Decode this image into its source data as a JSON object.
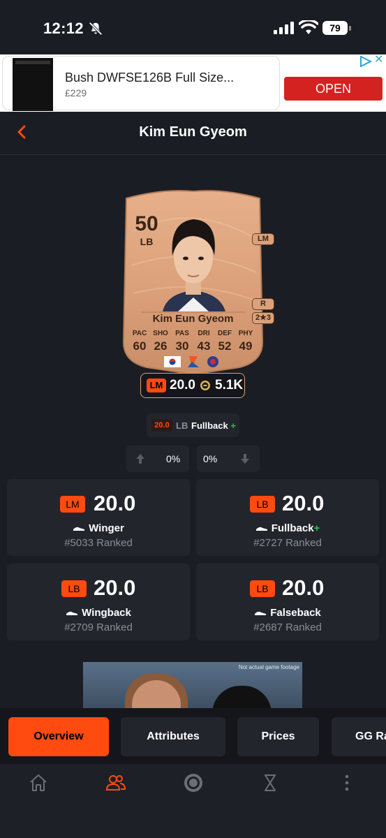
{
  "status": {
    "time": "12:12",
    "battery": "79"
  },
  "ad": {
    "title": "Bush DWFSE126B Full Size...",
    "price": "£229",
    "cta": "OPEN",
    "close": "✕"
  },
  "header": {
    "title": "Kim Eun Gyeom"
  },
  "card": {
    "rating": "50",
    "position": "LB",
    "alt_positions": [
      "LM",
      "R",
      "2★3"
    ],
    "name": "Kim Eun Gyeom",
    "stats": [
      {
        "label": "PAC",
        "value": "60"
      },
      {
        "label": "SHO",
        "value": "26"
      },
      {
        "label": "PAS",
        "value": "30"
      },
      {
        "label": "DRI",
        "value": "43"
      },
      {
        "label": "DEF",
        "value": "52"
      },
      {
        "label": "PHY",
        "value": "49"
      }
    ]
  },
  "price_pill": {
    "position": "LM",
    "rating": "20.0",
    "price": "5.1K"
  },
  "role_chip": {
    "score": "20.0",
    "position": "LB",
    "role": "Fullback",
    "plus": "+"
  },
  "trend": {
    "up": "0%",
    "down": "0%"
  },
  "roles": [
    {
      "position": "LM",
      "rating": "20.0",
      "role": "Winger",
      "plus": "",
      "rank": "#5033 Ranked"
    },
    {
      "position": "LB",
      "rating": "20.0",
      "role": "Fullback",
      "plus": "+",
      "rank": "#2727 Ranked"
    },
    {
      "position": "LB",
      "rating": "20.0",
      "role": "Wingback",
      "plus": "",
      "rank": "#2709 Ranked"
    },
    {
      "position": "LB",
      "rating": "20.0",
      "role": "Falseback",
      "plus": "",
      "rank": "#2687 Ranked"
    }
  ],
  "promo": {
    "note": "Not actual game footage"
  },
  "tabs": [
    {
      "label": "Overview",
      "active": true
    },
    {
      "label": "Attributes"
    },
    {
      "label": "Prices"
    },
    {
      "label": "GG Ra"
    }
  ],
  "colors": {
    "accent": "#ff4a10",
    "background": "#1b1d24",
    "panel": "#23252d",
    "card_bronze": "#d9a27c",
    "ad_button": "#d42220",
    "plus_green": "#27c24c"
  }
}
